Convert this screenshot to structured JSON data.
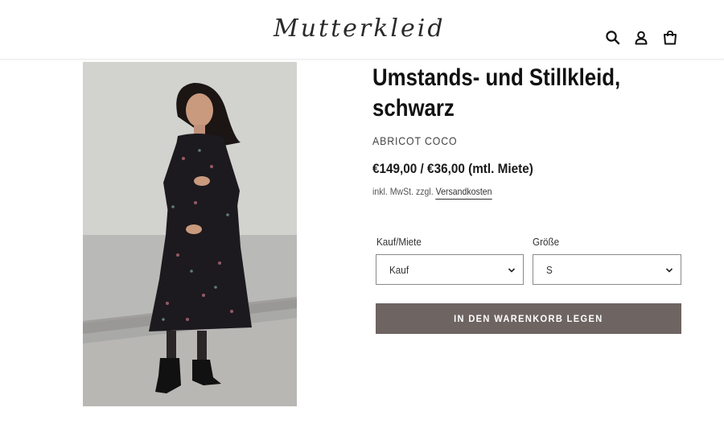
{
  "header": {
    "logo_text": "Mutterkleid",
    "icons": [
      "search-icon",
      "account-icon",
      "cart-icon"
    ]
  },
  "product": {
    "title": "Umstands- und Stillkleid, schwarz",
    "vendor": "ABRICOT COCO",
    "price": "€149,00 / €36,00 (mtl. Miete)",
    "tax_prefix": "inkl. MwSt. zzgl.",
    "tax_link": "Versandkosten",
    "image_alt": "Schwangere Frau in schwarzem geblümten Kleid"
  },
  "options": {
    "purchase": {
      "label": "Kauf/Miete",
      "value": "Kauf"
    },
    "size": {
      "label": "Größe",
      "value": "S"
    }
  },
  "add_to_cart_label": "IN DEN WARENKORB LEGEN",
  "colors": {
    "button_bg": "#6e6462",
    "dress": "#1c1a1e",
    "background_wall": "#cfcfcf"
  }
}
